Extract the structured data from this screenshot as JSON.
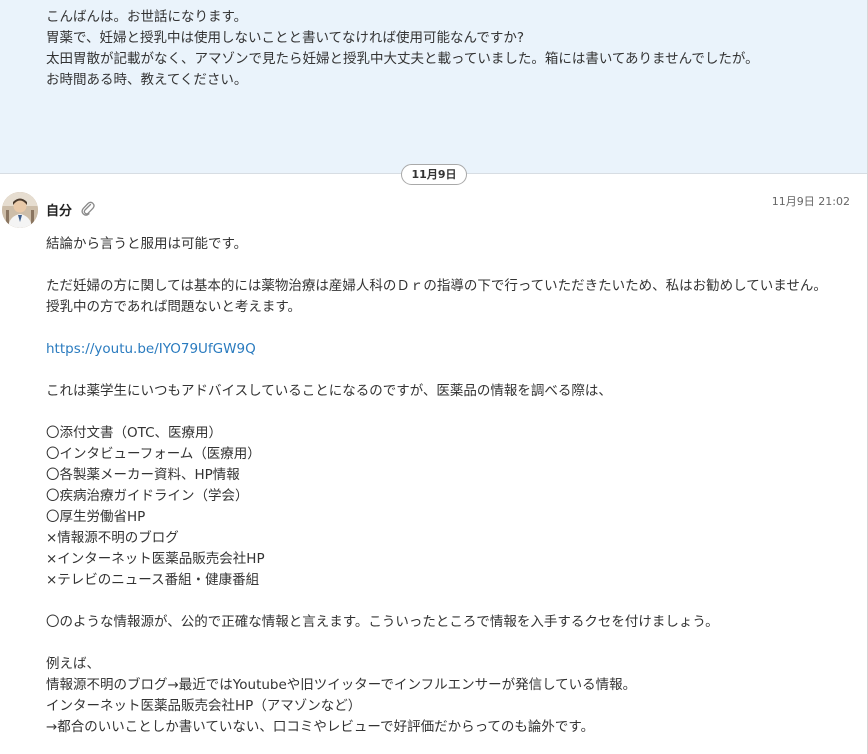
{
  "previous_message": {
    "lines": [
      "こんばんは。お世話になります。",
      "胃薬で、妊婦と授乳中は使用しないことと書いてなければ使用可能なんですか?",
      "太田胃散が記載がなく、アマゾンで見たら妊婦と授乳中大丈夫と載っていました。箱には書いてありませんでしたが。",
      "お時間ある時、教えてください。"
    ]
  },
  "date_separator": "11月9日",
  "message": {
    "sender": "自分",
    "timestamp": "11月9日 21:02",
    "icons": {
      "attachment": "paperclip-icon",
      "avatar": "user-avatar"
    },
    "lines": [
      "結論から言うと服用は可能です。",
      "",
      "ただ妊婦の方に関しては基本的には薬物治療は産婦人科のＤｒの指導の下で行っていただきたいため、私はお勧めしていません。",
      "授乳中の方であれば問題ないと考えます。",
      "",
      "https://youtu.be/IYO79UfGW9Q",
      "",
      "これは薬学生にいつもアドバイスしていることになるのですが、医薬品の情報を調べる際は、",
      "",
      "〇添付文書（OTC、医療用）",
      "〇インタビューフォーム（医療用）",
      "〇各製薬メーカー資料、HP情報",
      "〇疾病治療ガイドライン（学会）",
      "〇厚生労働省HP",
      "×情報源不明のブログ",
      "×インターネット医薬品販売会社HP",
      "×テレビのニュース番組・健康番組",
      "",
      "〇のような情報源が、公的で正確な情報と言えます。こういったところで情報を入手するクセを付けましょう。",
      "",
      "例えば、",
      "情報源不明のブログ→最近ではYoutubeや旧ツイッターでインフルエンサーが発信している情報。",
      "インターネット医薬品販売会社HP（アマゾンなど）",
      "→都合のいいことしか書いていない、口コミやレビューで好評価だからってのも論外です。"
    ]
  },
  "colors": {
    "previous_bg": "#eaf3fb",
    "link": "#2a7bbf",
    "text": "#333333"
  }
}
